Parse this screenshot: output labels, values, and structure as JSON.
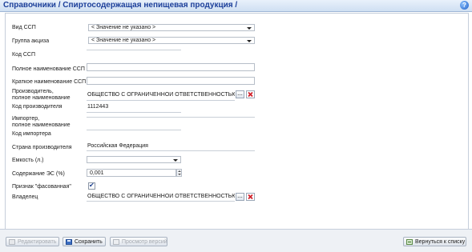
{
  "header": {
    "title": "Справочники / Спиртосодержащая непищевая продукция /",
    "help_symbol": "?"
  },
  "form": {
    "vid_ssp": {
      "label": "Вид ССП",
      "value": "< Значение не указано >"
    },
    "gruppa_akciza": {
      "label": "Группа акциза",
      "value": "< Значение не указано >"
    },
    "kod_ssp": {
      "label": "Код ССП",
      "value": ""
    },
    "full_name": {
      "label": "Полное наименование ССП",
      "value": ""
    },
    "short_name": {
      "label": "Краткое наименование ССП",
      "value": ""
    },
    "producer": {
      "label_line1": "Производитель,",
      "label_line2": "полное наименование",
      "value": "ОБЩЕСТВО С ОГРАНИЧЕННОЙ ОТВЕТСТВЕННОСТЬЮ \"КОС"
    },
    "producer_code": {
      "label": "Код производителя",
      "value": "1112443"
    },
    "importer": {
      "label_line1": "Импортер,",
      "label_line2": "полное наименование",
      "value": ""
    },
    "importer_code": {
      "label": "Код импортера",
      "value": ""
    },
    "country": {
      "label": "Страна производителя",
      "value": "Российская Федерация"
    },
    "capacity": {
      "label": "Емкость (л.)",
      "value": ""
    },
    "es_content": {
      "label": "Содержание ЭС (%)",
      "value": "0,001"
    },
    "packaged": {
      "label": "Признак \"фасованная\"",
      "checked": true
    },
    "owner": {
      "label": "Владелец",
      "value": "ОБЩЕСТВО С ОГРАНИЧЕННОЙ ОТВЕТСТВЕННОСТЬЮ \"КОС"
    },
    "ellipsis": "..."
  },
  "footer": {
    "edit_label": "Редактировать",
    "save_label": "Сохранить",
    "versions_label": "Просмотр версий",
    "back_label": "Вернуться к списку"
  }
}
